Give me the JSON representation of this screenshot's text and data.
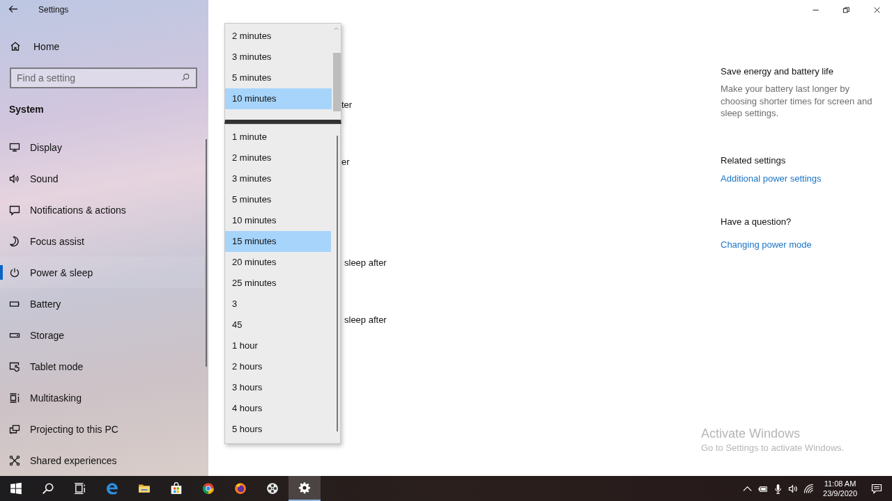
{
  "window": {
    "title": "Settings"
  },
  "sidebar": {
    "home": "Home",
    "search": {
      "placeholder": "Find a setting"
    },
    "section": "System",
    "items": [
      {
        "label": "Display",
        "kind": "display",
        "selected": false
      },
      {
        "label": "Sound",
        "kind": "sound",
        "selected": false
      },
      {
        "label": "Notifications & actions",
        "kind": "notifications",
        "selected": false
      },
      {
        "label": "Focus assist",
        "kind": "moon",
        "selected": false
      },
      {
        "label": "Power & sleep",
        "kind": "power",
        "selected": true
      },
      {
        "label": "Battery",
        "kind": "battery",
        "selected": false
      },
      {
        "label": "Storage",
        "kind": "storage",
        "selected": false
      },
      {
        "label": "Tablet mode",
        "kind": "tablet",
        "selected": false
      },
      {
        "label": "Multitasking",
        "kind": "multitasking",
        "selected": false
      },
      {
        "label": "Projecting to this PC",
        "kind": "projecting",
        "selected": false
      },
      {
        "label": "Shared experiences",
        "kind": "shared",
        "selected": false
      }
    ]
  },
  "main": {
    "labels": [
      "ter",
      "er",
      "sleep after",
      "sleep after"
    ],
    "dropdowns": [
      {
        "options": [
          {
            "label": "2 minutes",
            "selected": false
          },
          {
            "label": "3 minutes",
            "selected": false
          },
          {
            "label": "5 minutes",
            "selected": false
          },
          {
            "label": "10 minutes",
            "selected": true
          }
        ]
      },
      {
        "options": [
          {
            "label": "1 minute",
            "selected": false
          },
          {
            "label": "2 minutes",
            "selected": false
          },
          {
            "label": "3 minutes",
            "selected": false
          },
          {
            "label": "5 minutes",
            "selected": false
          },
          {
            "label": "10 minutes",
            "selected": false
          },
          {
            "label": "15 minutes",
            "selected": true
          },
          {
            "label": "20 minutes",
            "selected": false
          },
          {
            "label": "25 minutes",
            "selected": false
          },
          {
            "label": "3",
            "selected": false
          },
          {
            "label": "45",
            "selected": false
          },
          {
            "label": "1 hour",
            "selected": false
          },
          {
            "label": "2 hours",
            "selected": false
          },
          {
            "label": "3 hours",
            "selected": false
          },
          {
            "label": "4 hours",
            "selected": false
          },
          {
            "label": "5 hours",
            "selected": false
          }
        ]
      }
    ]
  },
  "side_panel": [
    {
      "heading": "Save energy and battery life",
      "text": "Make your battery last longer by choosing shorter times for screen and sleep settings."
    },
    {
      "heading": "Related settings",
      "link": "Additional power settings"
    },
    {
      "heading": "Have a question?",
      "link": "Changing power mode"
    }
  ],
  "watermark": {
    "title": "Activate Windows",
    "text": "Go to Settings to activate Windows."
  },
  "taskbar": {
    "apps": [
      {
        "kind": "start",
        "selected": false
      },
      {
        "kind": "search",
        "selected": false
      },
      {
        "kind": "taskview",
        "selected": false
      },
      {
        "kind": "edge",
        "selected": false
      },
      {
        "kind": "folder",
        "selected": false
      },
      {
        "kind": "store",
        "selected": false
      },
      {
        "kind": "chrome",
        "selected": false
      },
      {
        "kind": "firefox",
        "selected": false
      },
      {
        "kind": "reel",
        "selected": false
      },
      {
        "kind": "gear",
        "selected": true
      }
    ],
    "tray": [
      {
        "kind": "chevron"
      },
      {
        "kind": "battery"
      },
      {
        "kind": "mic"
      },
      {
        "kind": "volume"
      },
      {
        "kind": "wifi"
      }
    ],
    "clock": {
      "time": "11:08 AM",
      "date": "23/9/2020"
    }
  }
}
